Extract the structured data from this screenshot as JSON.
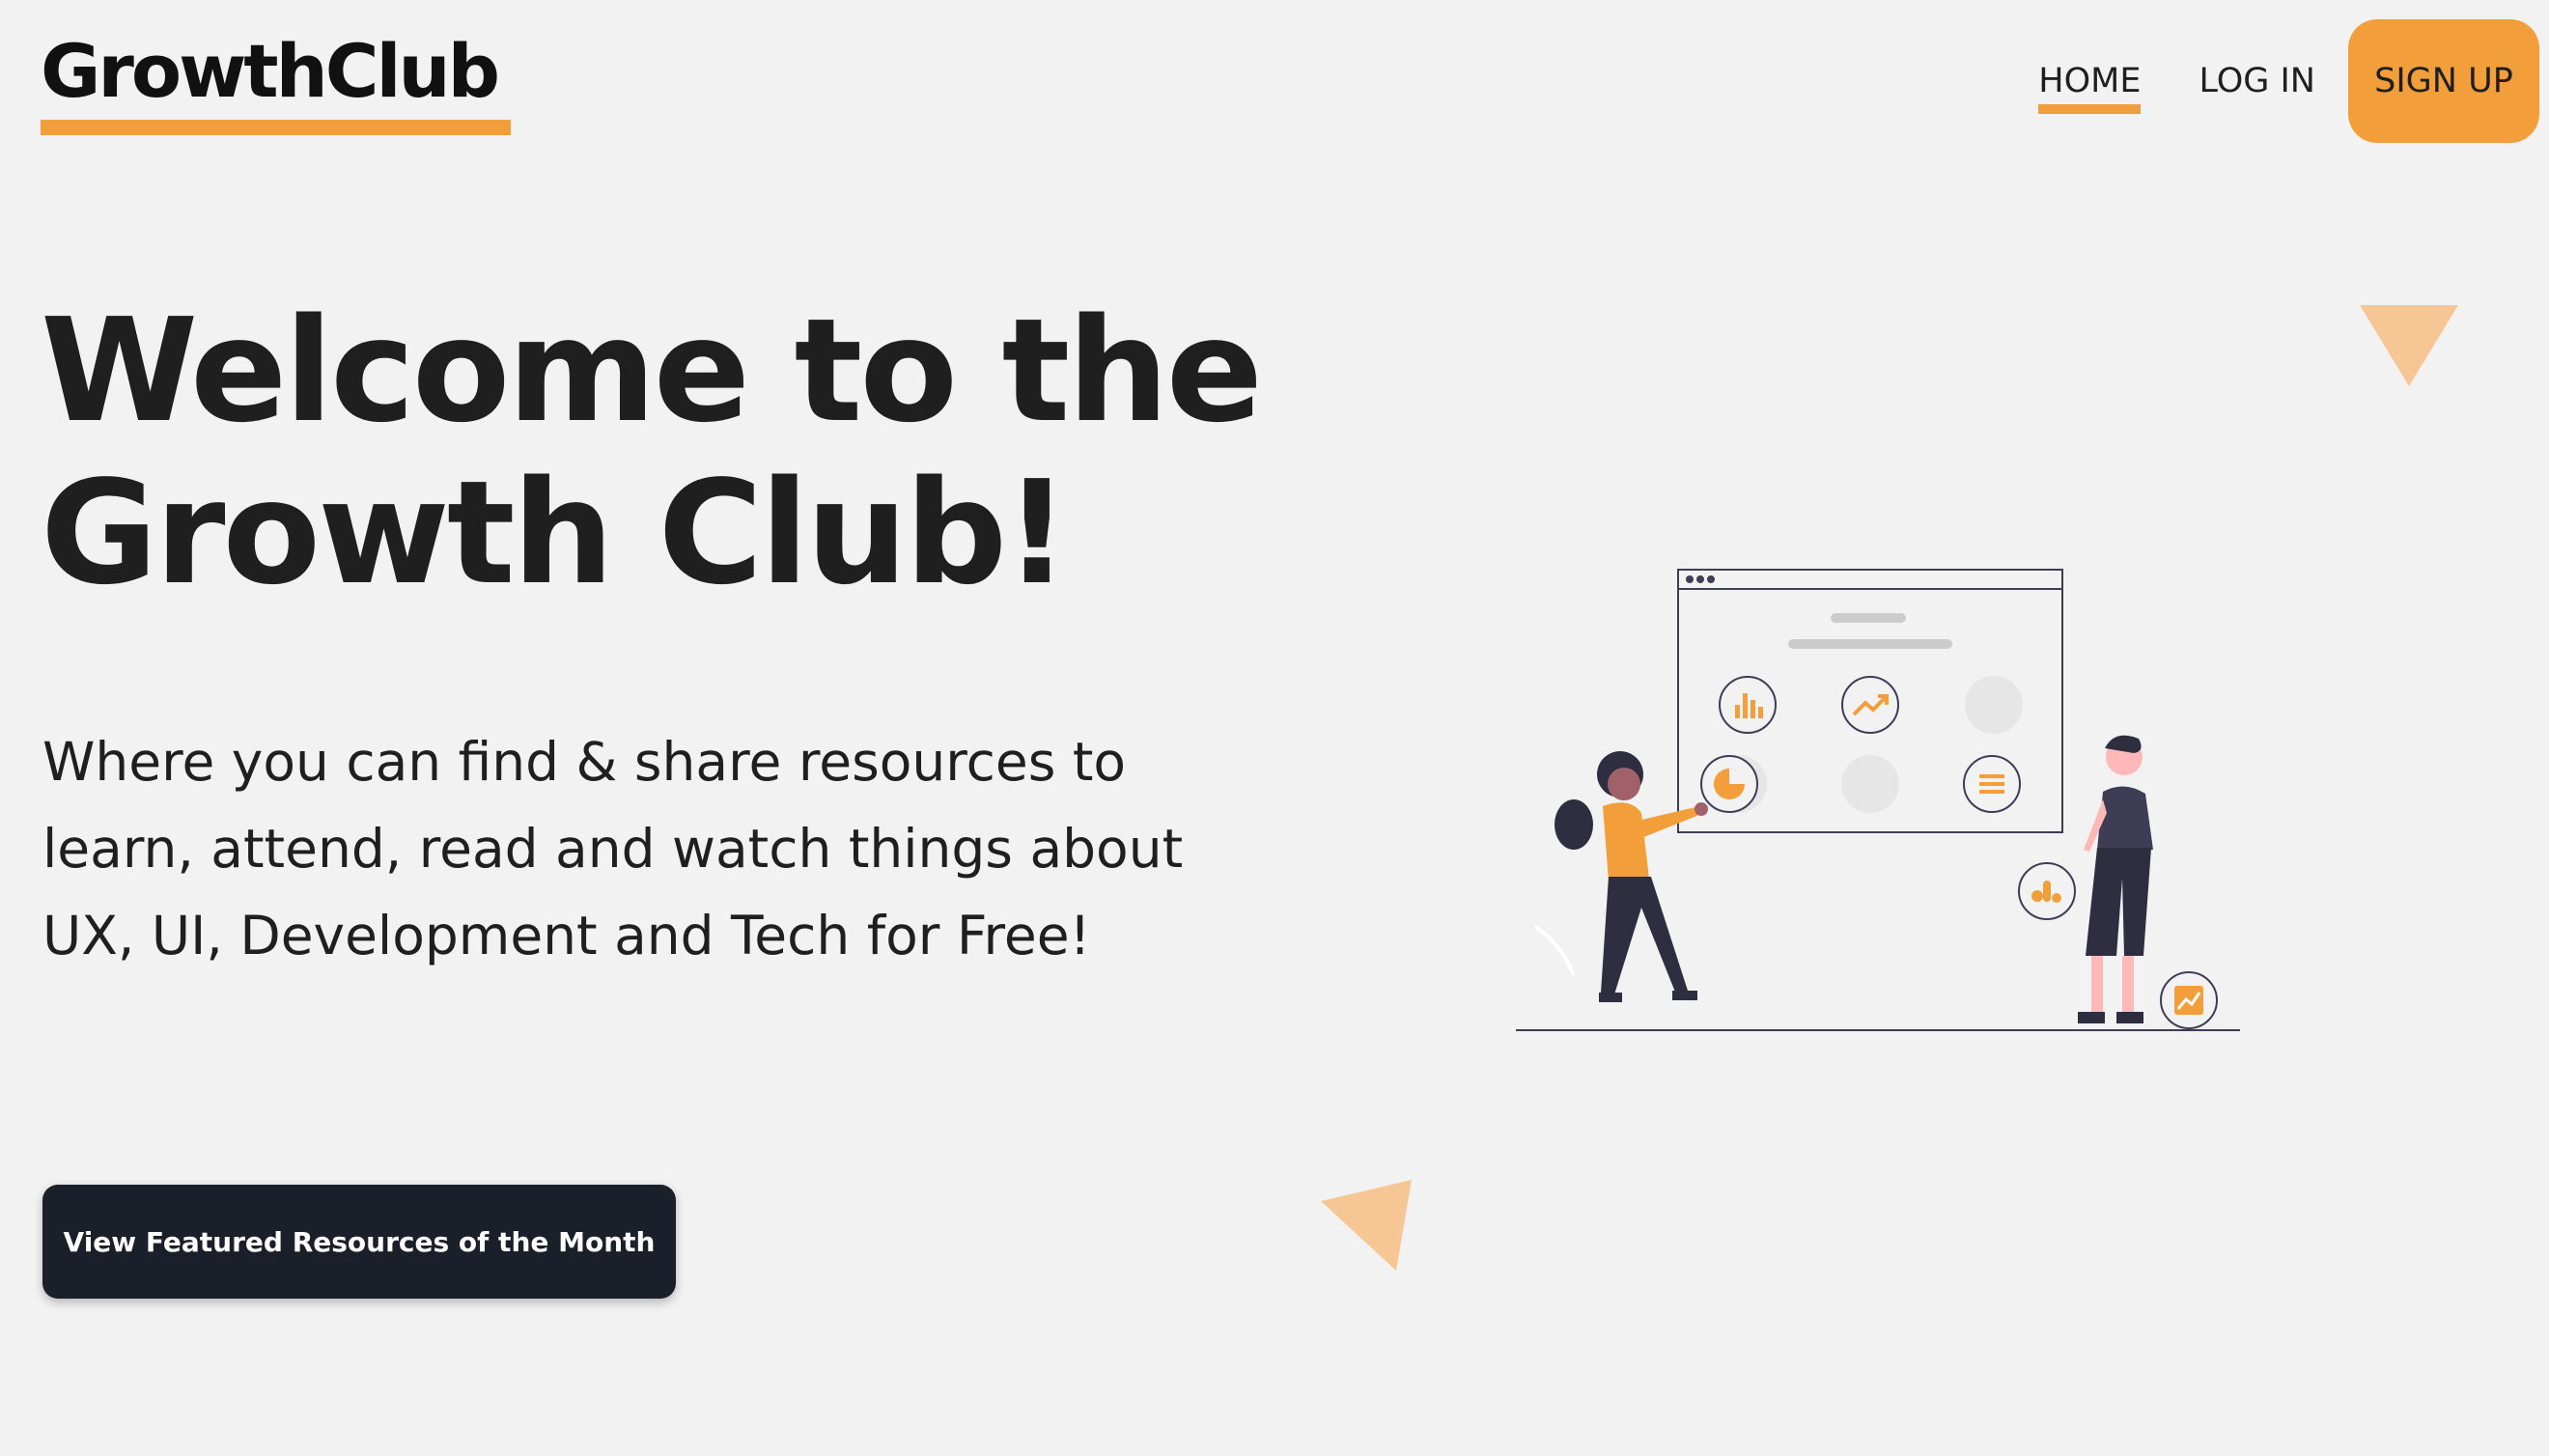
{
  "header": {
    "logo": "GrowthClub",
    "nav": {
      "home": "HOME",
      "login": "LOG IN",
      "signup": "SIGN UP"
    }
  },
  "hero": {
    "title_line1": "Welcome to the",
    "title_line2": "Growth Club!",
    "description": "Where you can find & share resources to learn, attend, read and watch things about UX, UI, Development and Tech for Free!",
    "cta_label": "View Featured Resources of the Month"
  },
  "colors": {
    "background": "#f2f2f2",
    "accent": "#f29f3b",
    "accent_light": "#f6c795",
    "dark": "#1b1f2a",
    "text": "#1f1f1f"
  },
  "icons": [
    "logo-underline",
    "triangle-decoration-top-right",
    "triangle-decoration-middle",
    "dashboard-illustration",
    "bar-chart-icon",
    "trend-up-icon",
    "pie-chart-icon",
    "list-icon",
    "chart-icon"
  ]
}
